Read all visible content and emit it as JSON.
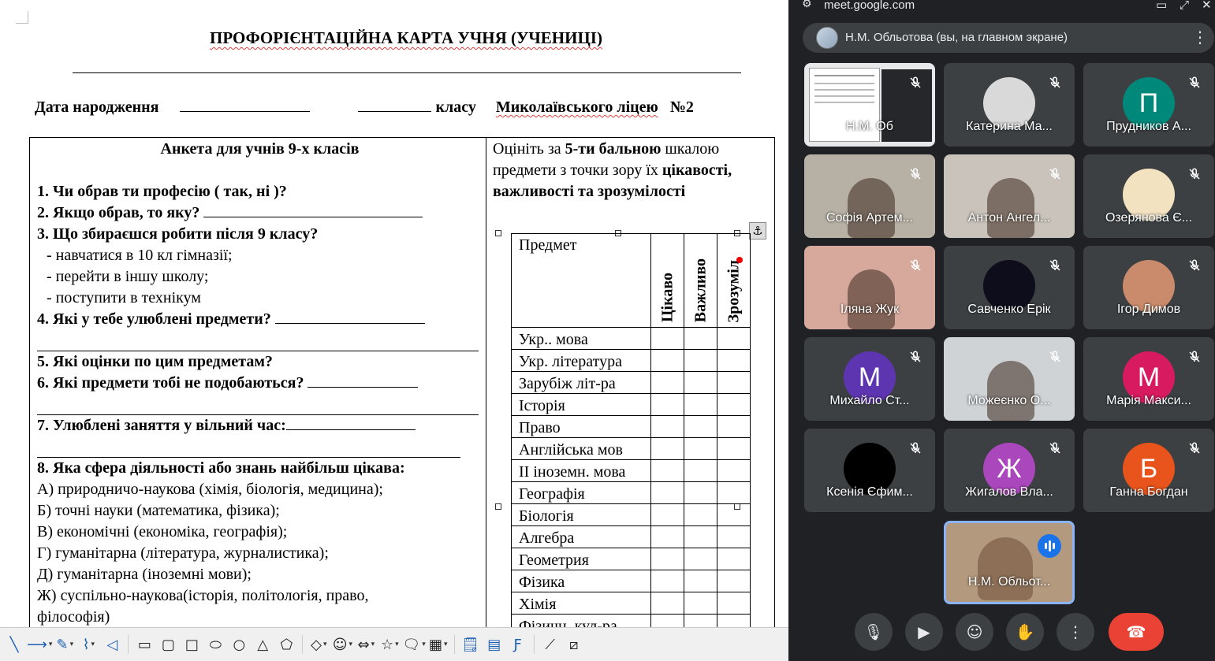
{
  "document": {
    "title": "ПРОФОРІЄНТАЦІЙНА КАРТА УЧНЯ (УЧЕНИЦІ)",
    "birth_label": "Дата народження",
    "class_label": "класу",
    "school_label": "Миколаївського ліцею",
    "school_number": "№2",
    "anketa_title": "Анкета для учнів 9-х класів",
    "questions": {
      "q1": "1. Чи обрав ти професію ( так, ні )?",
      "q2": "2. Якщо обрав, то яку?",
      "q3": "3. Що збираєшся робити після 9 класу?",
      "q3_opt1": "- навчатися в 10 кл гімназії;",
      "q3_opt2": "- перейти в іншу школу;",
      "q3_opt3": "- поступити в технікум",
      "q4": "4. Які у тебе улюблені предмети?",
      "q5": "5. Які оцінки по цим предметам?",
      "q6": "6. Які предмети тобі не подобаються?",
      "q7": "7. Улюблені заняття у вільний час:",
      "q8": "8. Яка сфера діяльності або знань найбільш цікава:",
      "q8_a": "А) природничо-наукова (хімія, біологія, медицина);",
      "q8_b": "Б) точні науки (математика, фізика);",
      "q8_c": "В) економічні (економіка, географія);",
      "q8_d": "Г) гуманітарна (література, журналистика);",
      "q8_e": "Д) гуманітарна (іноземні мови);",
      "q8_f1": "Ж) суспільно-наукова(історія, політологія, право,",
      "q8_f2": "філософія)"
    },
    "rating_intro": {
      "p1": "Оцініть за ",
      "p2": "5-ти бальною",
      "p3": " шкалою предмети з точки зору їх ",
      "p4": "цікавості, важливості та зрозумілості"
    },
    "subject_table": {
      "header_subject": "Предмет",
      "header_cols": [
        "Цікаво",
        "Важливо",
        "Зрозуміл"
      ],
      "subjects": [
        "Укр.. мова",
        "Укр. література",
        "Зарубіж літ-ра",
        "Історія",
        "Право",
        "Англійська мов",
        "ІІ іноземн. мова",
        "Географія",
        "Біологія",
        "Алгебра",
        "Геометрия",
        "Фізика",
        "Хімія",
        "Фізичн. кул-ра"
      ]
    },
    "anchor_icon": "anchor-icon"
  },
  "meet": {
    "url": "meet.google.com",
    "presenter_text": "Н.М. Обльотова (вы, на главном экране)",
    "screen_share_label": "Н.М. Об",
    "participants": [
      {
        "name": "Катерина Ма...",
        "type": "photo",
        "color": "#d9d9d9"
      },
      {
        "name": "Прудников А...",
        "type": "letter",
        "letter": "П",
        "color": "#00897b"
      },
      {
        "name": "Софія Артем...",
        "type": "video",
        "color": "#b7b0a4"
      },
      {
        "name": "Антон Ангел...",
        "type": "video",
        "color": "#c9c3bb"
      },
      {
        "name": "Озерянова Є...",
        "type": "photo",
        "color": "#f3e2c0"
      },
      {
        "name": "Іляна Жук",
        "type": "video",
        "color": "#d6a99c"
      },
      {
        "name": "Савченко Ерік",
        "type": "photo",
        "color": "#0d0d1c"
      },
      {
        "name": "Ігор Димов",
        "type": "photo",
        "color": "#c98b6b"
      },
      {
        "name": "Михайло Ст...",
        "type": "letter",
        "letter": "М",
        "color": "#5e35b1"
      },
      {
        "name": "Можеєнко О...",
        "type": "video",
        "color": "#cfd3d6"
      },
      {
        "name": "Марія Макси...",
        "type": "letter",
        "letter": "М",
        "color": "#d81b60"
      },
      {
        "name": "Ксенія Єфим...",
        "type": "photo",
        "color": "#000000"
      },
      {
        "name": "Жигалов Вла...",
        "type": "letter",
        "letter": "Ж",
        "color": "#ab47bc"
      },
      {
        "name": "Ганна Богдан",
        "type": "letter",
        "letter": "Б",
        "color": "#e8541c"
      }
    ],
    "self_tile_name": "Н.М. Обльот...",
    "controls": [
      "mic-icon",
      "camera-icon",
      "emoji-icon",
      "raise-hand-icon",
      "more-options-icon",
      "end-call-icon"
    ]
  }
}
